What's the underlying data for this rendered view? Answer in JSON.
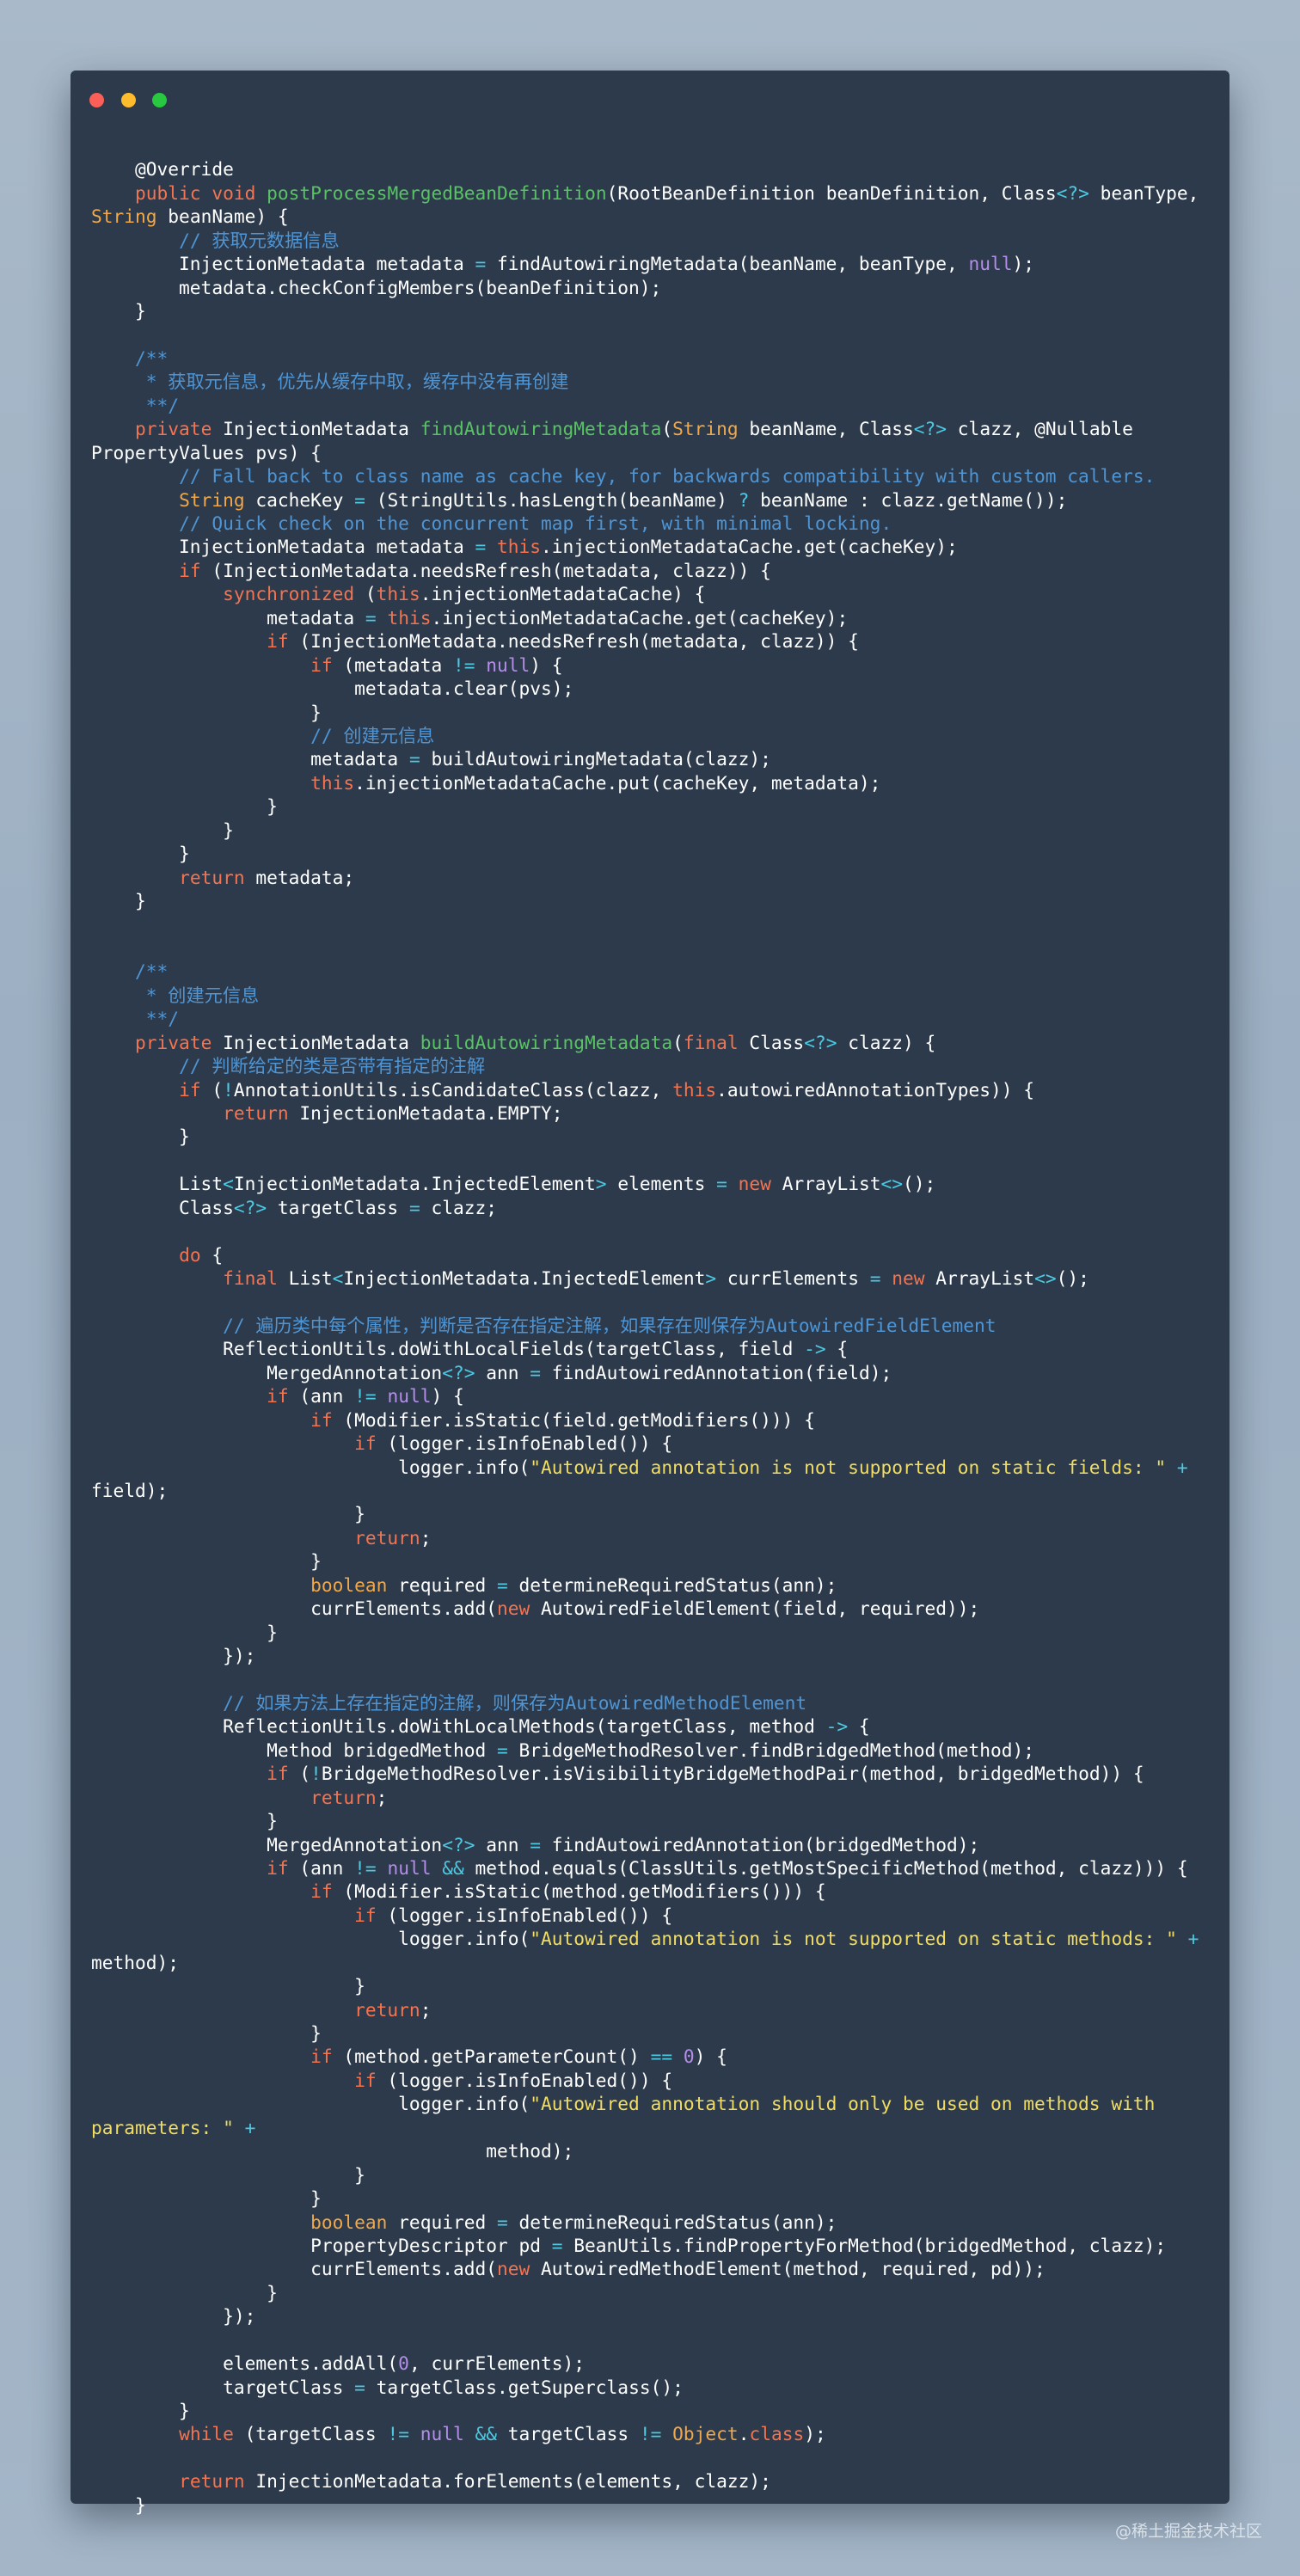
{
  "window": {
    "controls": [
      {
        "name": "close",
        "color": "#fc5f57"
      },
      {
        "name": "minimize",
        "color": "#fdbc2e"
      },
      {
        "name": "maximize",
        "color": "#28c840"
      }
    ]
  },
  "syntax_colors": {
    "plain": "#ffffff",
    "keyword": "#f5734f",
    "type": "#f0a84a",
    "method": "#59c364",
    "comment": "#4f95d4",
    "operator": "#4ec9e2",
    "literal": "#b48ee8",
    "string": "#f2dd60"
  },
  "code_lines": [
    [
      [
        "p",
        ""
      ]
    ],
    [
      [
        "p",
        "    @Override"
      ]
    ],
    [
      [
        "p",
        "    "
      ],
      [
        "k",
        "public"
      ],
      [
        "p",
        " "
      ],
      [
        "k",
        "void"
      ],
      [
        "p",
        " "
      ],
      [
        "m",
        "postProcessMergedBeanDefinition"
      ],
      [
        "p",
        "(RootBeanDefinition beanDefinition, Class"
      ],
      [
        "o",
        "<?>"
      ],
      [
        "p",
        " beanType,"
      ]
    ],
    [
      [
        "t",
        "String"
      ],
      [
        "p",
        " beanName) {"
      ]
    ],
    [
      [
        "p",
        "        "
      ],
      [
        "c",
        "// 获取元数据信息"
      ]
    ],
    [
      [
        "p",
        "        InjectionMetadata metadata "
      ],
      [
        "o",
        "="
      ],
      [
        "p",
        " findAutowiringMetadata(beanName, beanType, "
      ],
      [
        "l",
        "null"
      ],
      [
        "p",
        ");"
      ]
    ],
    [
      [
        "p",
        "        metadata.checkConfigMembers(beanDefinition);"
      ]
    ],
    [
      [
        "p",
        "    }"
      ]
    ],
    [
      [
        "p",
        ""
      ]
    ],
    [
      [
        "p",
        "    "
      ],
      [
        "c",
        "/**"
      ]
    ],
    [
      [
        "p",
        "     "
      ],
      [
        "c",
        "* 获取元信息，优先从缓存中取，缓存中没有再创建"
      ]
    ],
    [
      [
        "p",
        "     "
      ],
      [
        "c",
        "**/"
      ]
    ],
    [
      [
        "p",
        "    "
      ],
      [
        "k",
        "private"
      ],
      [
        "p",
        " InjectionMetadata "
      ],
      [
        "m",
        "findAutowiringMetadata"
      ],
      [
        "p",
        "("
      ],
      [
        "t",
        "String"
      ],
      [
        "p",
        " beanName, Class"
      ],
      [
        "o",
        "<?>"
      ],
      [
        "p",
        " clazz, @Nullable"
      ]
    ],
    [
      [
        "p",
        "PropertyValues pvs) {"
      ]
    ],
    [
      [
        "p",
        "        "
      ],
      [
        "c",
        "// Fall back to class name as cache key, for backwards compatibility with custom callers."
      ]
    ],
    [
      [
        "p",
        "        "
      ],
      [
        "t",
        "String"
      ],
      [
        "p",
        " cacheKey "
      ],
      [
        "o",
        "="
      ],
      [
        "p",
        " (StringUtils.hasLength(beanName) "
      ],
      [
        "o",
        "?"
      ],
      [
        "p",
        " beanName : clazz.getName());"
      ]
    ],
    [
      [
        "p",
        "        "
      ],
      [
        "c",
        "// Quick check on the concurrent map first, with minimal locking."
      ]
    ],
    [
      [
        "p",
        "        InjectionMetadata metadata "
      ],
      [
        "o",
        "="
      ],
      [
        "p",
        " "
      ],
      [
        "k",
        "this"
      ],
      [
        "p",
        ".injectionMetadataCache.get(cacheKey);"
      ]
    ],
    [
      [
        "p",
        "        "
      ],
      [
        "k",
        "if"
      ],
      [
        "p",
        " (InjectionMetadata.needsRefresh(metadata, clazz)) {"
      ]
    ],
    [
      [
        "p",
        "            "
      ],
      [
        "k",
        "synchronized"
      ],
      [
        "p",
        " ("
      ],
      [
        "k",
        "this"
      ],
      [
        "p",
        ".injectionMetadataCache) {"
      ]
    ],
    [
      [
        "p",
        "                metadata "
      ],
      [
        "o",
        "="
      ],
      [
        "p",
        " "
      ],
      [
        "k",
        "this"
      ],
      [
        "p",
        ".injectionMetadataCache.get(cacheKey);"
      ]
    ],
    [
      [
        "p",
        "                "
      ],
      [
        "k",
        "if"
      ],
      [
        "p",
        " (InjectionMetadata.needsRefresh(metadata, clazz)) {"
      ]
    ],
    [
      [
        "p",
        "                    "
      ],
      [
        "k",
        "if"
      ],
      [
        "p",
        " (metadata "
      ],
      [
        "o",
        "!="
      ],
      [
        "p",
        " "
      ],
      [
        "l",
        "null"
      ],
      [
        "p",
        ") {"
      ]
    ],
    [
      [
        "p",
        "                        metadata.clear(pvs);"
      ]
    ],
    [
      [
        "p",
        "                    }"
      ]
    ],
    [
      [
        "p",
        "                    "
      ],
      [
        "c",
        "// 创建元信息"
      ]
    ],
    [
      [
        "p",
        "                    metadata "
      ],
      [
        "o",
        "="
      ],
      [
        "p",
        " buildAutowiringMetadata(clazz);"
      ]
    ],
    [
      [
        "p",
        "                    "
      ],
      [
        "k",
        "this"
      ],
      [
        "p",
        ".injectionMetadataCache.put(cacheKey, metadata);"
      ]
    ],
    [
      [
        "p",
        "                }"
      ]
    ],
    [
      [
        "p",
        "            }"
      ]
    ],
    [
      [
        "p",
        "        }"
      ]
    ],
    [
      [
        "p",
        "        "
      ],
      [
        "k",
        "return"
      ],
      [
        "p",
        " metadata;"
      ]
    ],
    [
      [
        "p",
        "    }"
      ]
    ],
    [
      [
        "p",
        ""
      ]
    ],
    [
      [
        "p",
        ""
      ]
    ],
    [
      [
        "p",
        "    "
      ],
      [
        "c",
        "/**"
      ]
    ],
    [
      [
        "p",
        "     "
      ],
      [
        "c",
        "* 创建元信息"
      ]
    ],
    [
      [
        "p",
        "     "
      ],
      [
        "c",
        "**/"
      ]
    ],
    [
      [
        "p",
        "    "
      ],
      [
        "k",
        "private"
      ],
      [
        "p",
        " InjectionMetadata "
      ],
      [
        "m",
        "buildAutowiringMetadata"
      ],
      [
        "p",
        "("
      ],
      [
        "k",
        "final"
      ],
      [
        "p",
        " Class"
      ],
      [
        "o",
        "<?>"
      ],
      [
        "p",
        " clazz) {"
      ]
    ],
    [
      [
        "p",
        "        "
      ],
      [
        "c",
        "// 判断给定的类是否带有指定的注解"
      ]
    ],
    [
      [
        "p",
        "        "
      ],
      [
        "k",
        "if"
      ],
      [
        "p",
        " ("
      ],
      [
        "o",
        "!"
      ],
      [
        "p",
        "AnnotationUtils.isCandidateClass(clazz, "
      ],
      [
        "k",
        "this"
      ],
      [
        "p",
        ".autowiredAnnotationTypes)) {"
      ]
    ],
    [
      [
        "p",
        "            "
      ],
      [
        "k",
        "return"
      ],
      [
        "p",
        " InjectionMetadata.EMPTY;"
      ]
    ],
    [
      [
        "p",
        "        }"
      ]
    ],
    [
      [
        "p",
        ""
      ]
    ],
    [
      [
        "p",
        "        List"
      ],
      [
        "o",
        "<"
      ],
      [
        "p",
        "InjectionMetadata.InjectedElement"
      ],
      [
        "o",
        ">"
      ],
      [
        "p",
        " elements "
      ],
      [
        "o",
        "="
      ],
      [
        "p",
        " "
      ],
      [
        "k",
        "new"
      ],
      [
        "p",
        " ArrayList"
      ],
      [
        "o",
        "<>"
      ],
      [
        "p",
        "();"
      ]
    ],
    [
      [
        "p",
        "        Class"
      ],
      [
        "o",
        "<?>"
      ],
      [
        "p",
        " targetClass "
      ],
      [
        "o",
        "="
      ],
      [
        "p",
        " clazz;"
      ]
    ],
    [
      [
        "p",
        ""
      ]
    ],
    [
      [
        "p",
        "        "
      ],
      [
        "k",
        "do"
      ],
      [
        "p",
        " {"
      ]
    ],
    [
      [
        "p",
        "            "
      ],
      [
        "k",
        "final"
      ],
      [
        "p",
        " List"
      ],
      [
        "o",
        "<"
      ],
      [
        "p",
        "InjectionMetadata.InjectedElement"
      ],
      [
        "o",
        ">"
      ],
      [
        "p",
        " currElements "
      ],
      [
        "o",
        "="
      ],
      [
        "p",
        " "
      ],
      [
        "k",
        "new"
      ],
      [
        "p",
        " ArrayList"
      ],
      [
        "o",
        "<>"
      ],
      [
        "p",
        "();"
      ]
    ],
    [
      [
        "p",
        ""
      ]
    ],
    [
      [
        "p",
        "            "
      ],
      [
        "c",
        "// 遍历类中每个属性，判断是否存在指定注解，如果存在则保存为AutowiredFieldElement"
      ]
    ],
    [
      [
        "p",
        "            ReflectionUtils.doWithLocalFields(targetClass, field "
      ],
      [
        "o",
        "->"
      ],
      [
        "p",
        " {"
      ]
    ],
    [
      [
        "p",
        "                MergedAnnotation"
      ],
      [
        "o",
        "<?>"
      ],
      [
        "p",
        " ann "
      ],
      [
        "o",
        "="
      ],
      [
        "p",
        " findAutowiredAnnotation(field);"
      ]
    ],
    [
      [
        "p",
        "                "
      ],
      [
        "k",
        "if"
      ],
      [
        "p",
        " (ann "
      ],
      [
        "o",
        "!="
      ],
      [
        "p",
        " "
      ],
      [
        "l",
        "null"
      ],
      [
        "p",
        ") {"
      ]
    ],
    [
      [
        "p",
        "                    "
      ],
      [
        "k",
        "if"
      ],
      [
        "p",
        " (Modifier.isStatic(field.getModifiers())) {"
      ]
    ],
    [
      [
        "p",
        "                        "
      ],
      [
        "k",
        "if"
      ],
      [
        "p",
        " (logger.isInfoEnabled()) {"
      ]
    ],
    [
      [
        "p",
        "                            logger.info("
      ],
      [
        "s",
        "\"Autowired annotation is not supported on static fields: \""
      ],
      [
        "p",
        " "
      ],
      [
        "o",
        "+"
      ]
    ],
    [
      [
        "p",
        "field);"
      ]
    ],
    [
      [
        "p",
        "                        }"
      ]
    ],
    [
      [
        "p",
        "                        "
      ],
      [
        "k",
        "return"
      ],
      [
        "p",
        ";"
      ]
    ],
    [
      [
        "p",
        "                    }"
      ]
    ],
    [
      [
        "p",
        "                    "
      ],
      [
        "t",
        "boolean"
      ],
      [
        "p",
        " required "
      ],
      [
        "o",
        "="
      ],
      [
        "p",
        " determineRequiredStatus(ann);"
      ]
    ],
    [
      [
        "p",
        "                    currElements.add("
      ],
      [
        "k",
        "new"
      ],
      [
        "p",
        " AutowiredFieldElement(field, required));"
      ]
    ],
    [
      [
        "p",
        "                }"
      ]
    ],
    [
      [
        "p",
        "            });"
      ]
    ],
    [
      [
        "p",
        ""
      ]
    ],
    [
      [
        "p",
        "            "
      ],
      [
        "c",
        "// 如果方法上存在指定的注解，则保存为AutowiredMethodElement"
      ]
    ],
    [
      [
        "p",
        "            ReflectionUtils.doWithLocalMethods(targetClass, method "
      ],
      [
        "o",
        "->"
      ],
      [
        "p",
        " {"
      ]
    ],
    [
      [
        "p",
        "                Method bridgedMethod "
      ],
      [
        "o",
        "="
      ],
      [
        "p",
        " BridgeMethodResolver.findBridgedMethod(method);"
      ]
    ],
    [
      [
        "p",
        "                "
      ],
      [
        "k",
        "if"
      ],
      [
        "p",
        " ("
      ],
      [
        "o",
        "!"
      ],
      [
        "p",
        "BridgeMethodResolver.isVisibilityBridgeMethodPair(method, bridgedMethod)) {"
      ]
    ],
    [
      [
        "p",
        "                    "
      ],
      [
        "k",
        "return"
      ],
      [
        "p",
        ";"
      ]
    ],
    [
      [
        "p",
        "                }"
      ]
    ],
    [
      [
        "p",
        "                MergedAnnotation"
      ],
      [
        "o",
        "<?>"
      ],
      [
        "p",
        " ann "
      ],
      [
        "o",
        "="
      ],
      [
        "p",
        " findAutowiredAnnotation(bridgedMethod);"
      ]
    ],
    [
      [
        "p",
        "                "
      ],
      [
        "k",
        "if"
      ],
      [
        "p",
        " (ann "
      ],
      [
        "o",
        "!="
      ],
      [
        "p",
        " "
      ],
      [
        "l",
        "null"
      ],
      [
        "p",
        " "
      ],
      [
        "o",
        "&&"
      ],
      [
        "p",
        " method.equals(ClassUtils.getMostSpecificMethod(method, clazz))) {"
      ]
    ],
    [
      [
        "p",
        "                    "
      ],
      [
        "k",
        "if"
      ],
      [
        "p",
        " (Modifier.isStatic(method.getModifiers())) {"
      ]
    ],
    [
      [
        "p",
        "                        "
      ],
      [
        "k",
        "if"
      ],
      [
        "p",
        " (logger.isInfoEnabled()) {"
      ]
    ],
    [
      [
        "p",
        "                            logger.info("
      ],
      [
        "s",
        "\"Autowired annotation is not supported on static methods: \""
      ],
      [
        "p",
        " "
      ],
      [
        "o",
        "+"
      ]
    ],
    [
      [
        "p",
        "method);"
      ]
    ],
    [
      [
        "p",
        "                        }"
      ]
    ],
    [
      [
        "p",
        "                        "
      ],
      [
        "k",
        "return"
      ],
      [
        "p",
        ";"
      ]
    ],
    [
      [
        "p",
        "                    }"
      ]
    ],
    [
      [
        "p",
        "                    "
      ],
      [
        "k",
        "if"
      ],
      [
        "p",
        " (method.getParameterCount() "
      ],
      [
        "o",
        "=="
      ],
      [
        "p",
        " "
      ],
      [
        "l",
        "0"
      ],
      [
        "p",
        ") {"
      ]
    ],
    [
      [
        "p",
        "                        "
      ],
      [
        "k",
        "if"
      ],
      [
        "p",
        " (logger.isInfoEnabled()) {"
      ]
    ],
    [
      [
        "p",
        "                            logger.info("
      ],
      [
        "s",
        "\"Autowired annotation should only be used on methods with"
      ]
    ],
    [
      [
        "s",
        "parameters: \""
      ],
      [
        "p",
        " "
      ],
      [
        "o",
        "+"
      ]
    ],
    [
      [
        "p",
        "                                    method);"
      ]
    ],
    [
      [
        "p",
        "                        }"
      ]
    ],
    [
      [
        "p",
        "                    }"
      ]
    ],
    [
      [
        "p",
        "                    "
      ],
      [
        "t",
        "boolean"
      ],
      [
        "p",
        " required "
      ],
      [
        "o",
        "="
      ],
      [
        "p",
        " determineRequiredStatus(ann);"
      ]
    ],
    [
      [
        "p",
        "                    PropertyDescriptor pd "
      ],
      [
        "o",
        "="
      ],
      [
        "p",
        " BeanUtils.findPropertyForMethod(bridgedMethod, clazz);"
      ]
    ],
    [
      [
        "p",
        "                    currElements.add("
      ],
      [
        "k",
        "new"
      ],
      [
        "p",
        " AutowiredMethodElement(method, required, pd));"
      ]
    ],
    [
      [
        "p",
        "                }"
      ]
    ],
    [
      [
        "p",
        "            });"
      ]
    ],
    [
      [
        "p",
        ""
      ]
    ],
    [
      [
        "p",
        "            elements.addAll("
      ],
      [
        "l",
        "0"
      ],
      [
        "p",
        ", currElements);"
      ]
    ],
    [
      [
        "p",
        "            targetClass "
      ],
      [
        "o",
        "="
      ],
      [
        "p",
        " targetClass.getSuperclass();"
      ]
    ],
    [
      [
        "p",
        "        }"
      ]
    ],
    [
      [
        "p",
        "        "
      ],
      [
        "k",
        "while"
      ],
      [
        "p",
        " (targetClass "
      ],
      [
        "o",
        "!="
      ],
      [
        "p",
        " "
      ],
      [
        "l",
        "null"
      ],
      [
        "p",
        " "
      ],
      [
        "o",
        "&&"
      ],
      [
        "p",
        " targetClass "
      ],
      [
        "o",
        "!="
      ],
      [
        "p",
        " "
      ],
      [
        "t",
        "Object"
      ],
      [
        "p",
        "."
      ],
      [
        "k",
        "class"
      ],
      [
        "p",
        ");"
      ]
    ],
    [
      [
        "p",
        ""
      ]
    ],
    [
      [
        "p",
        "        "
      ],
      [
        "k",
        "return"
      ],
      [
        "p",
        " InjectionMetadata.forElements(elements, clazz);"
      ]
    ],
    [
      [
        "p",
        "    }"
      ]
    ]
  ],
  "watermark": "@稀土掘金技术社区"
}
